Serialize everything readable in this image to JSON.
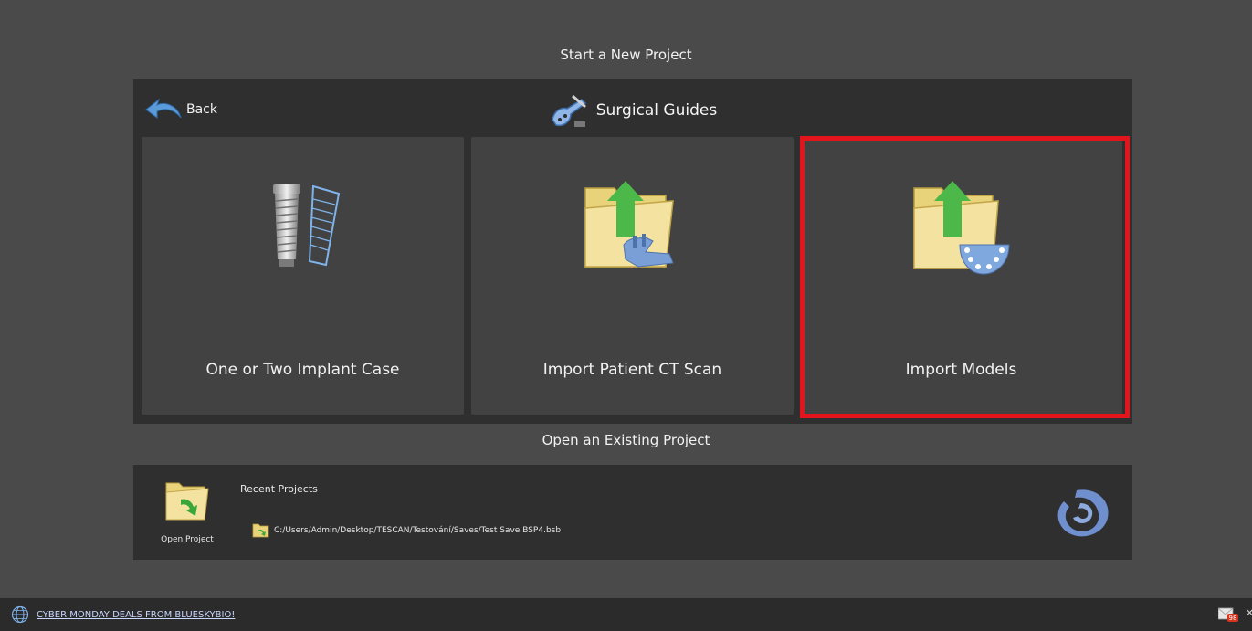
{
  "header": {
    "new_project_title": "Start a New Project"
  },
  "panel": {
    "back_label": "Back",
    "title": "Surgical Guides",
    "tiles": [
      {
        "label": "One or Two Implant Case",
        "icon": "implant-icon"
      },
      {
        "label": "Import Patient CT Scan",
        "icon": "import-ct-folder-icon"
      },
      {
        "label": "Import Models",
        "icon": "import-models-folder-icon"
      }
    ],
    "highlight_color": "#e3141b"
  },
  "open_section": {
    "title": "Open an Existing Project",
    "open_label": "Open Project",
    "recent_heading": "Recent Projects",
    "recent_items": [
      "C:/Users/Admin/Desktop/TESCAN/Testování/Saves/Test Save BSP4.bsb"
    ]
  },
  "footer": {
    "promo_text": "CYBER MONDAY DEALS FROM BLUESKYBIO!",
    "mail_badge": "98",
    "close_glyph": "×"
  }
}
